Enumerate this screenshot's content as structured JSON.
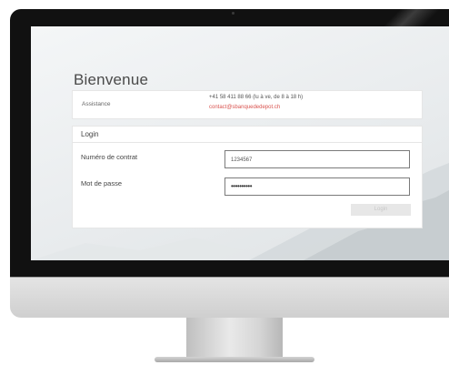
{
  "page": {
    "title": "Bienvenue"
  },
  "assistance": {
    "label": "Assistance",
    "phone": "+41 58 411 88 66 (lu à ve, de 8 à 18 h)",
    "email": "contact@sbanquededepot.ch"
  },
  "login": {
    "heading": "Login",
    "contract_label": "Numéro de contrat",
    "contract_value": "1234567",
    "password_label": "Mot de passe",
    "password_value": "••••••••••",
    "button_label": "Login"
  },
  "colors": {
    "accent_link": "#d9534f",
    "button_disabled": "#e7e7e7"
  }
}
